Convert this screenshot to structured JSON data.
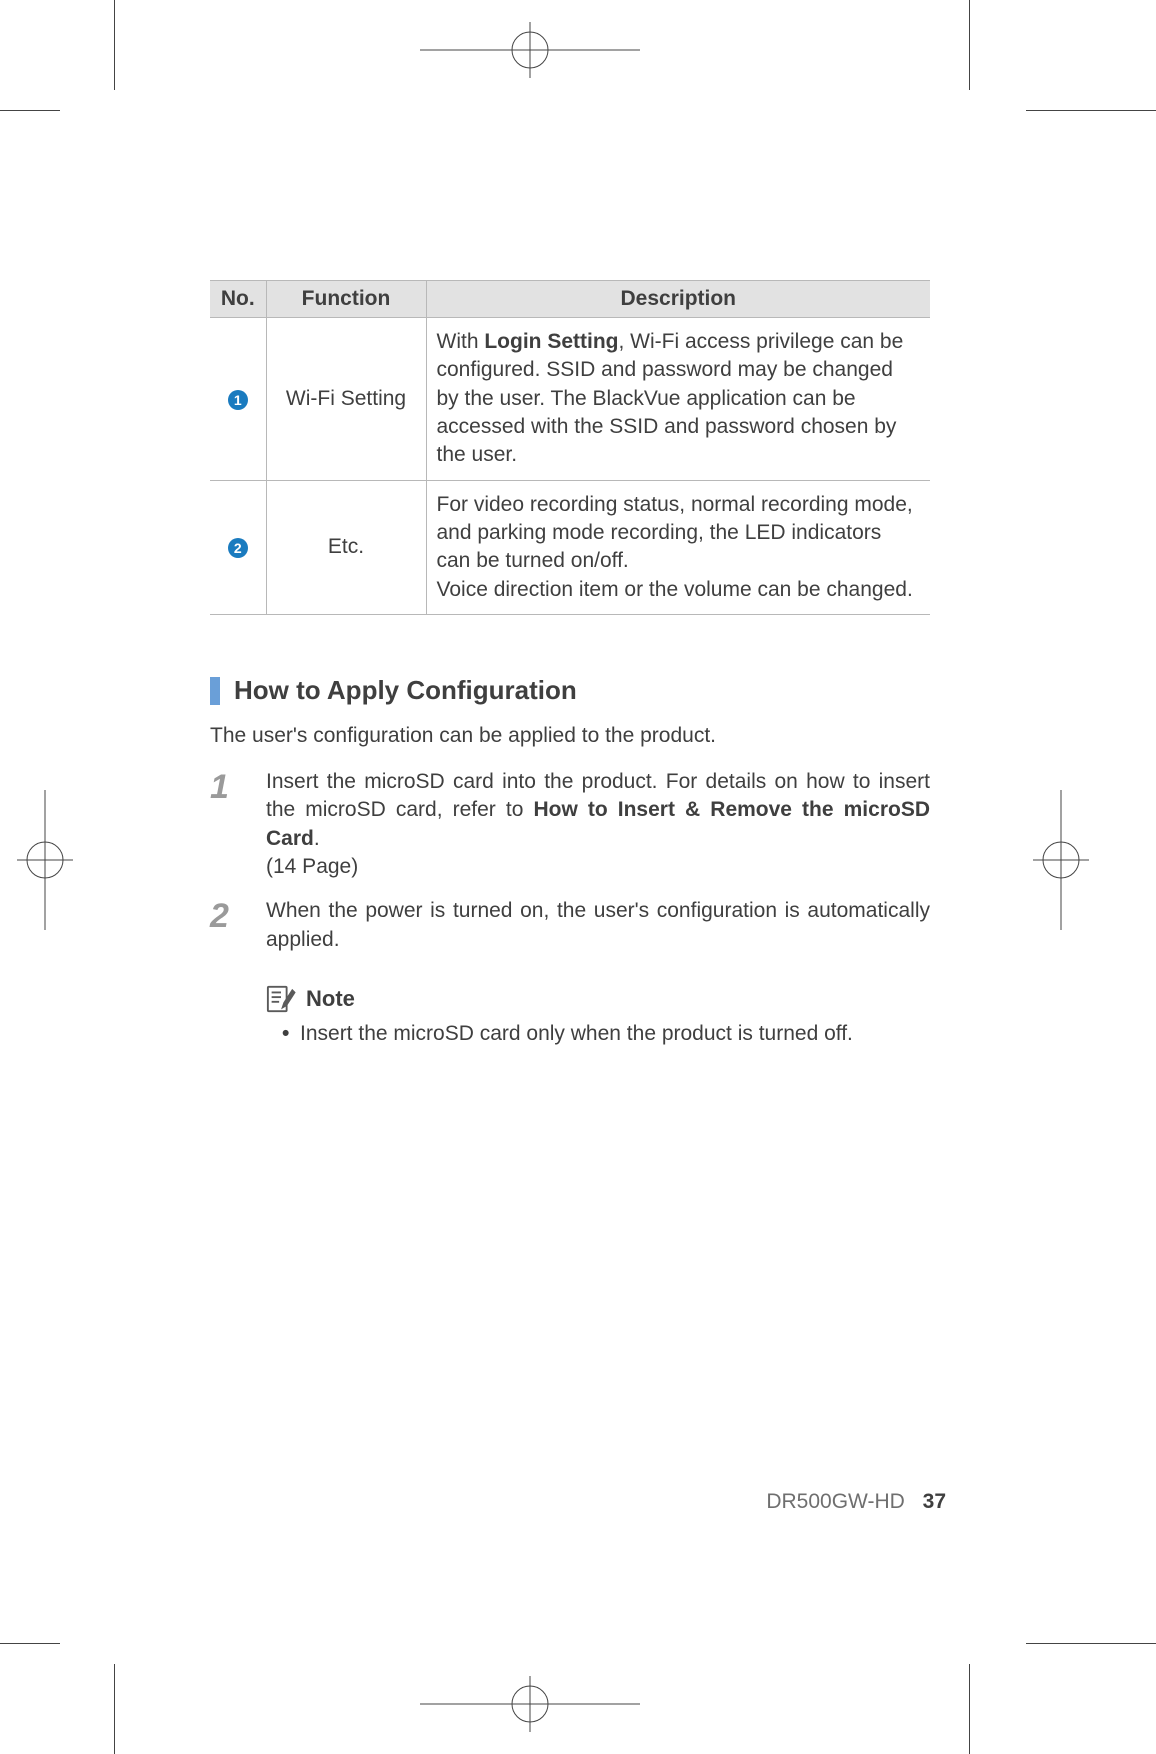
{
  "table": {
    "headers": {
      "no": "No.",
      "function": "Function",
      "description": "Description"
    },
    "rows": [
      {
        "num": "1",
        "function": "Wi-Fi Setting",
        "desc_pre": "With ",
        "desc_bold": "Login Setting",
        "desc_post": ", Wi-Fi access privilege can be configured. SSID and password may be changed by the user. The BlackVue application can be accessed with the SSID and password chosen by the user."
      },
      {
        "num": "2",
        "function": "Etc.",
        "desc_plain": "For video recording status, normal recording mode, and parking mode recording, the LED indicators can be turned on/off.\nVoice direction item or the volume can be changed."
      }
    ]
  },
  "section": {
    "title": "How to Apply Configuration",
    "intro": "The user's configuration can be applied to the product."
  },
  "steps": [
    {
      "n": "1",
      "text_pre": "Insert the microSD card into the product. For details on how to insert the microSD card, refer to ",
      "text_bold": "How to Insert & Remove the microSD Card",
      "text_post": ".",
      "page_ref": "(14 Page)"
    },
    {
      "n": "2",
      "text_plain": "When the power is turned on, the user's configuration is automatically applied."
    }
  ],
  "note": {
    "label": "Note",
    "items": [
      "Insert the microSD card only when the product is turned off."
    ]
  },
  "footer": {
    "model": "DR500GW-HD",
    "page": "37"
  }
}
